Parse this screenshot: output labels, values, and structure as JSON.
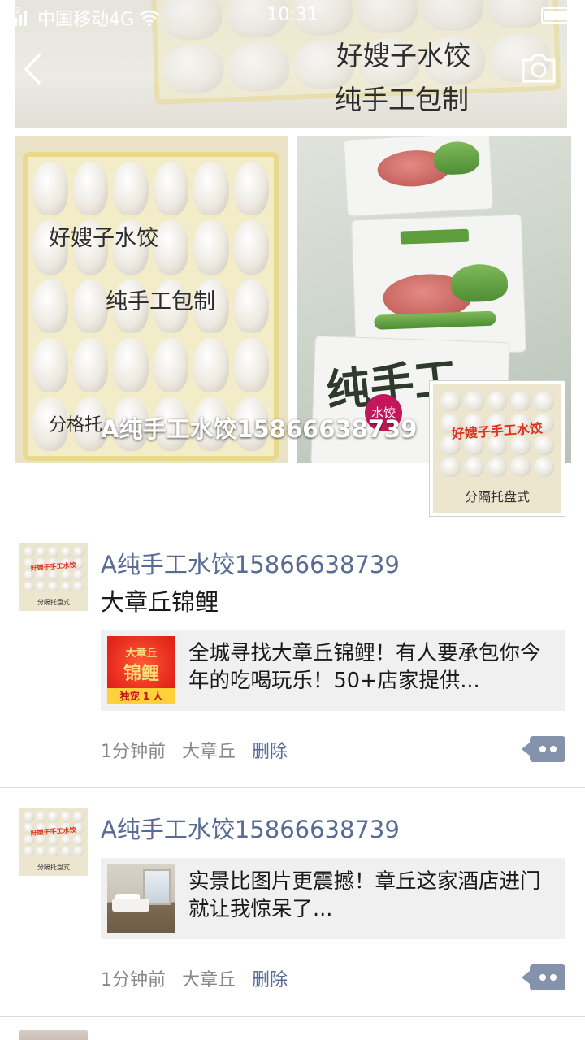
{
  "status_bar": {
    "signal_label": "4G",
    "carrier": "中国移动4G",
    "time": "10:31",
    "battery_level": 0.9
  },
  "cover": {
    "top_photo": {
      "caption_line1": "好嫂子水饺",
      "caption_line2": "纯手工包制"
    },
    "left_photo": {
      "caption_line1": "好嫂子水饺",
      "caption_line2": "纯手工包制",
      "caption_line3": "分格托"
    },
    "right_photo": {
      "package_text": "纯手工",
      "badge_text": "水饺"
    },
    "profile_name": "A纯手工水饺15866638739"
  },
  "avatar": {
    "red_text": "好嫂子手工水饺",
    "bottom_text": "分隔托盘式"
  },
  "posts": [
    {
      "author": "A纯手工水饺15866638739",
      "text": "大章丘锦鲤",
      "link": {
        "title": "全城寻找大章丘锦鲤！有人要承包你今年的吃喝玩乐！50+店家提供...",
        "thumb_top": "大章丘",
        "thumb_main": "锦鲤",
        "thumb_band": "独宠 1 人"
      },
      "time": "1分钟前",
      "location": "大章丘",
      "delete_label": "删除"
    },
    {
      "author": "A纯手工水饺15866638739",
      "text": "",
      "link": {
        "title": "实景比图片更震撼！章丘这家酒店进门就让我惊呆了..."
      },
      "time": "1分钟前",
      "location": "大章丘",
      "delete_label": "删除"
    }
  ],
  "icons": {
    "back": "chevron-left-icon",
    "camera": "camera-icon",
    "comment": "comment-icon",
    "wifi": "wifi-icon",
    "signal": "signal-icon",
    "battery": "battery-icon"
  },
  "colors": {
    "link_name": "#576b95",
    "comment_button": "#8592ab",
    "card_background": "#f0f0f0"
  }
}
